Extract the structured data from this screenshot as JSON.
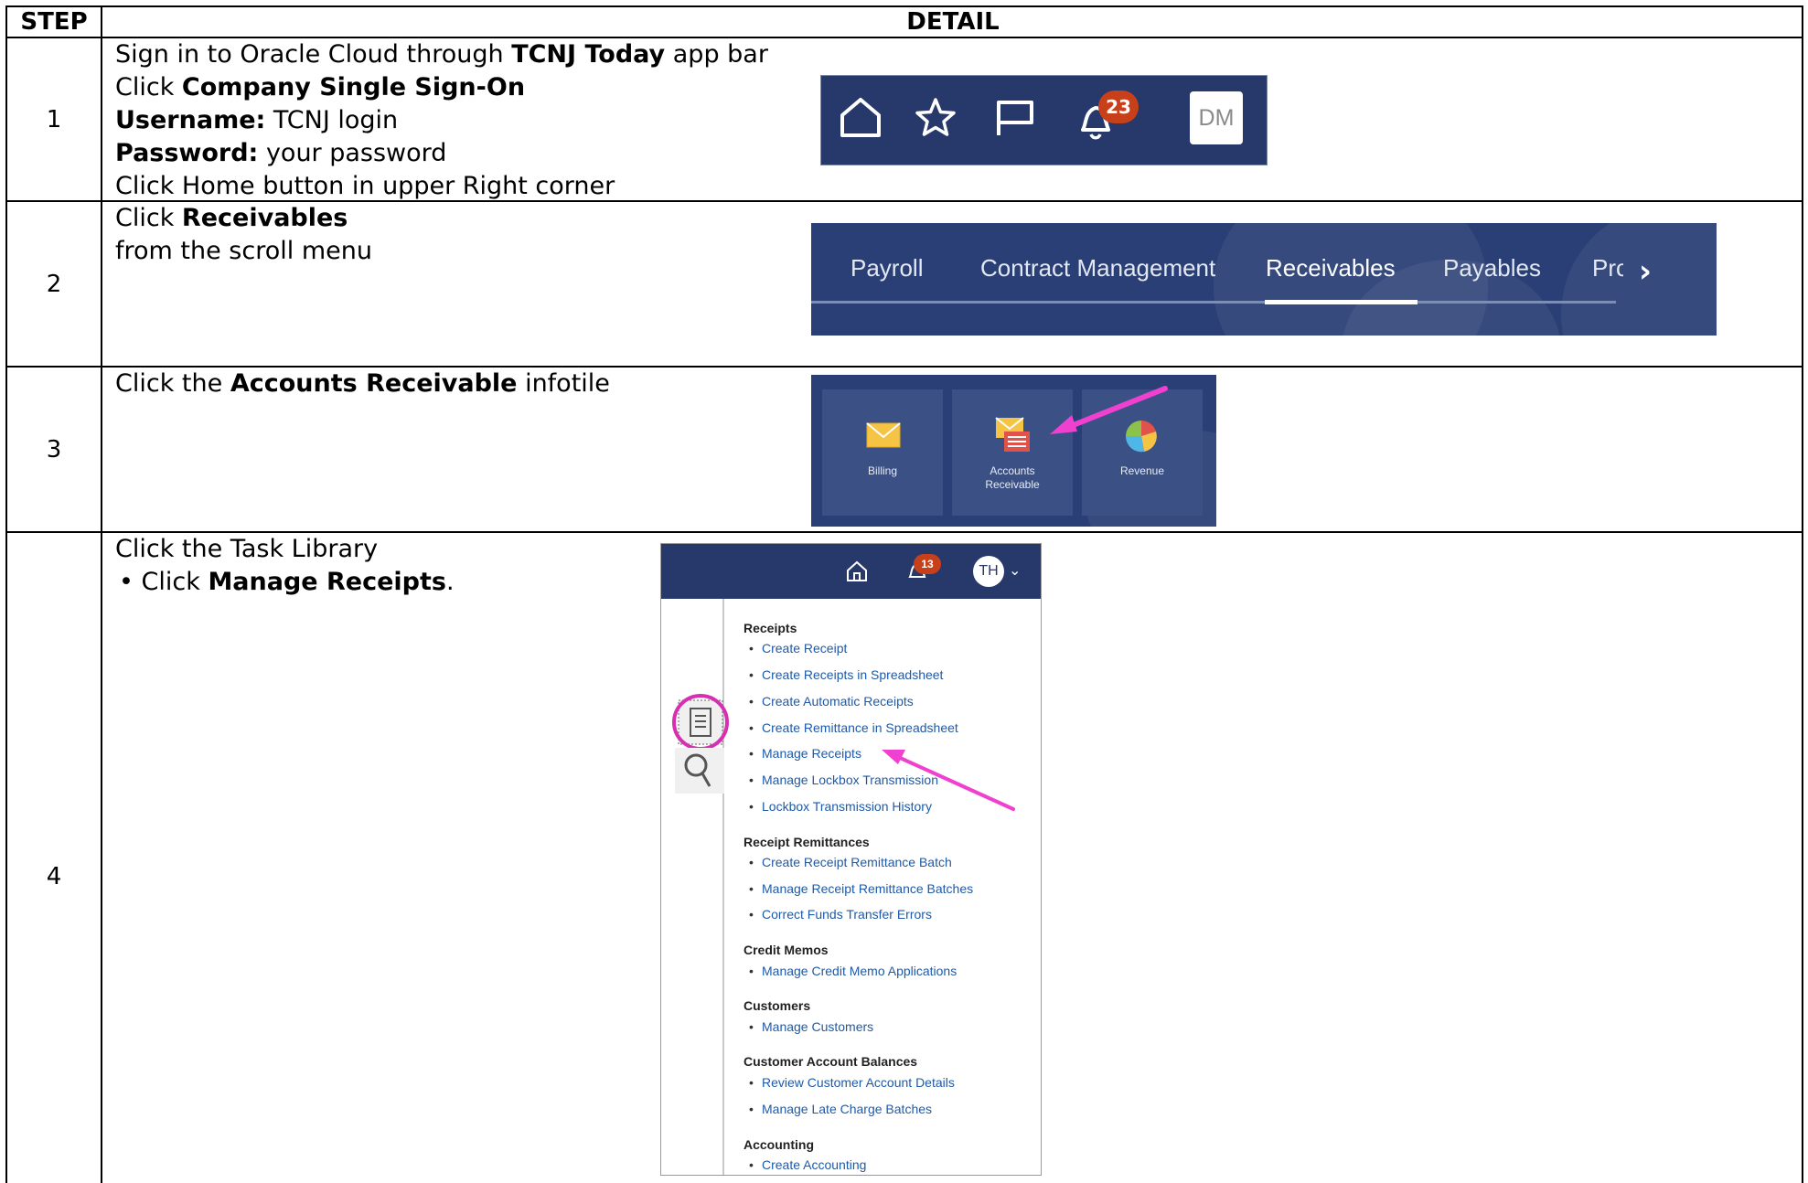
{
  "header": {
    "step": "STEP",
    "detail": "DETAIL"
  },
  "steps": [
    {
      "number": "1",
      "lines": [
        {
          "pre": "Sign in to Oracle Cloud through ",
          "bold": "TCNJ Today",
          "post": " app bar"
        },
        {
          "pre": "Click ",
          "bold": "Company Single Sign-On",
          "post": ""
        },
        {
          "pre": "",
          "bold": "Username:",
          "post": " TCNJ login"
        },
        {
          "pre": "",
          "bold": "Password:",
          "post": " your password"
        },
        {
          "pre": "Click Home button in upper Right corner",
          "bold": "",
          "post": ""
        }
      ]
    },
    {
      "number": "2",
      "lines": [
        {
          "pre": "Click ",
          "bold": "Receivables",
          "post": ""
        },
        {
          "pre": "from the scroll menu",
          "bold": "",
          "post": ""
        }
      ]
    },
    {
      "number": "3",
      "lines": [
        {
          "pre": "Click the ",
          "bold": "Accounts Receivable",
          "post": " infotile"
        }
      ]
    },
    {
      "number": "4",
      "lines": [
        {
          "pre": "Click the Task Library",
          "bold": "",
          "post": ""
        },
        {
          "pre": "•  Click ",
          "bold": "Manage Receipts",
          "post": "."
        }
      ]
    }
  ],
  "appbar": {
    "icons": [
      "home-icon",
      "star-icon",
      "flag-icon",
      "bell-icon"
    ],
    "notification_count": "23",
    "avatar_initials": "DM",
    "colors": {
      "bar": "#26396a",
      "badge": "#c8401a"
    }
  },
  "nav": {
    "items": [
      "Payroll",
      "Contract Management",
      "Receivables",
      "Payables",
      "Prc"
    ],
    "selected": "Receivables",
    "next_icon": "chevron-right-icon"
  },
  "tiles": [
    {
      "label": "Billing",
      "icon": "envelope-icon"
    },
    {
      "label": "Accounts Receivable",
      "label_line1": "Accounts",
      "label_line2": "Receivable",
      "icon": "envelope-document-icon"
    },
    {
      "label": "Revenue",
      "icon": "pie-chart-icon"
    }
  ],
  "task_library": {
    "notification_count": "13",
    "avatar_initials": "TH",
    "sections": [
      {
        "title": "Receipts",
        "links": [
          "Create Receipt",
          "Create Receipts in Spreadsheet",
          "Create Automatic Receipts",
          "Create Remittance in Spreadsheet",
          "Manage Receipts",
          "Manage Lockbox Transmission",
          "Lockbox Transmission History"
        ]
      },
      {
        "title": "Receipt Remittances",
        "links": [
          "Create Receipt Remittance Batch",
          "Manage Receipt Remittance Batches",
          "Correct Funds Transfer Errors"
        ]
      },
      {
        "title": "Credit Memos",
        "links": [
          "Manage Credit Memo Applications"
        ]
      },
      {
        "title": "Customers",
        "links": [
          "Manage Customers"
        ]
      },
      {
        "title": "Customer Account Balances",
        "links": [
          "Review Customer Account Details",
          "Manage Late Charge Batches"
        ]
      },
      {
        "title": "Accounting",
        "links": [
          "Create Accounting"
        ]
      }
    ],
    "highlight_color": "#e040c0",
    "arrow_color": "#f040d0"
  }
}
